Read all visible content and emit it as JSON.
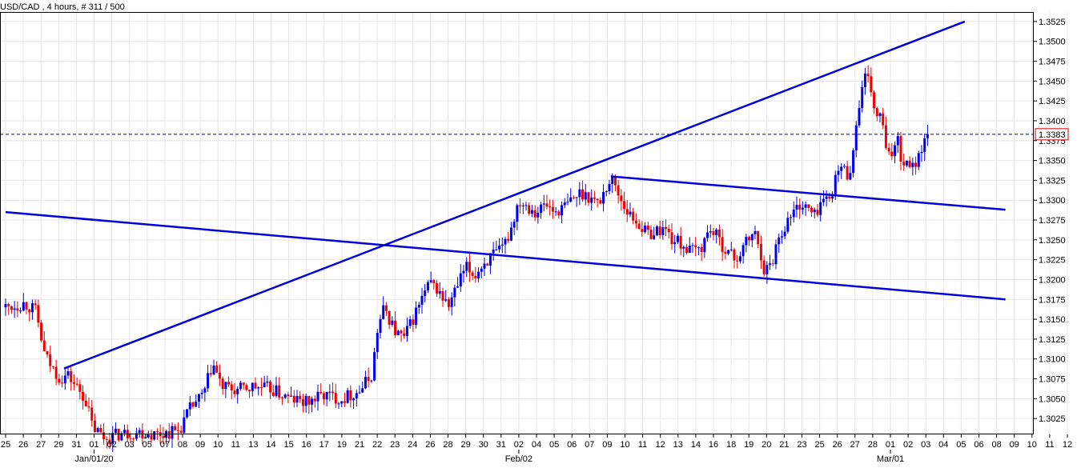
{
  "chart_data": {
    "type": "candlestick",
    "title": "USD/CAD , 4 hours, # 311 / 500",
    "y_ticks": [
      "1.3025",
      "1.3050",
      "1.3075",
      "1.3100",
      "1.3125",
      "1.3150",
      "1.3175",
      "1.3200",
      "1.3225",
      "1.3250",
      "1.3275",
      "1.3300",
      "1.3325",
      "1.3350",
      "1.3375",
      "1.3400",
      "1.3425",
      "1.3450",
      "1.3475",
      "1.3500",
      "1.3525"
    ],
    "ylim": [
      1.3005,
      1.3537
    ],
    "grid": true,
    "x_day_labels": [
      "25",
      "26",
      "27",
      "29",
      "31",
      "01",
      "02",
      "03",
      "05",
      "07",
      "08",
      "09",
      "10",
      "11",
      "13",
      "14",
      "15",
      "16",
      "17",
      "19",
      "21",
      "22",
      "23",
      "24",
      "26",
      "28",
      "29",
      "30",
      "31",
      "02",
      "04",
      "05",
      "06",
      "07",
      "09",
      "10",
      "11",
      "12",
      "13",
      "14",
      "16",
      "18",
      "19",
      "20",
      "21",
      "23",
      "25",
      "26",
      "27",
      "28",
      "01",
      "02",
      "03",
      "04",
      "05",
      "06",
      "08",
      "09",
      "10",
      "11",
      "12"
    ],
    "x_month_labels": [
      {
        "label": "Jan/01/20",
        "under_day": "01"
      },
      {
        "label": "Feb/02",
        "under_day": "02"
      },
      {
        "label": "Mar/01",
        "under_day": "01"
      }
    ],
    "current_price": "1.3383",
    "current_price_value": 1.3383,
    "trendlines": [
      {
        "name": "rising",
        "from": [
          3.3,
          1.3088
        ],
        "to": [
          54.2,
          1.3525
        ]
      },
      {
        "name": "lower-falling",
        "from": [
          0,
          1.3285
        ],
        "to": [
          56.5,
          1.3175
        ]
      },
      {
        "name": "upper-falling",
        "from": [
          34.2,
          1.333
        ],
        "to": [
          56.5,
          1.3288
        ]
      }
    ],
    "path": [
      [
        0,
        1.3165
      ],
      [
        1.1,
        1.317
      ],
      [
        1.7,
        1.316
      ],
      [
        2.2,
        1.3105
      ],
      [
        2.6,
        1.309
      ],
      [
        3.1,
        1.3075
      ],
      [
        3.5,
        1.308
      ],
      [
        4.0,
        1.3065
      ],
      [
        4.5,
        1.305
      ],
      [
        4.9,
        1.3015
      ],
      [
        5.6,
        1.3
      ],
      [
        6.4,
        1.3005
      ],
      [
        7.5,
        1.3008
      ],
      [
        8.5,
        1.3005
      ],
      [
        9.8,
        1.301
      ],
      [
        10.5,
        1.304
      ],
      [
        11.2,
        1.3055
      ],
      [
        11.7,
        1.3095
      ],
      [
        12.2,
        1.3065
      ],
      [
        13.0,
        1.306
      ],
      [
        14.0,
        1.3065
      ],
      [
        15.0,
        1.3062
      ],
      [
        16.0,
        1.305
      ],
      [
        17.0,
        1.3045
      ],
      [
        18.0,
        1.3055
      ],
      [
        19.0,
        1.305
      ],
      [
        20.0,
        1.306
      ],
      [
        20.7,
        1.308
      ],
      [
        21.0,
        1.3135
      ],
      [
        21.4,
        1.3165
      ],
      [
        22.0,
        1.3135
      ],
      [
        22.5,
        1.3125
      ],
      [
        23.0,
        1.315
      ],
      [
        23.6,
        1.318
      ],
      [
        24.0,
        1.3195
      ],
      [
        24.5,
        1.3185
      ],
      [
        25.0,
        1.3165
      ],
      [
        25.5,
        1.319
      ],
      [
        26.0,
        1.3215
      ],
      [
        26.5,
        1.3205
      ],
      [
        27.0,
        1.322
      ],
      [
        27.5,
        1.323
      ],
      [
        28.0,
        1.3235
      ],
      [
        28.5,
        1.326
      ],
      [
        29.0,
        1.33
      ],
      [
        29.4,
        1.3295
      ],
      [
        30.0,
        1.3285
      ],
      [
        30.5,
        1.3295
      ],
      [
        31.0,
        1.3285
      ],
      [
        31.5,
        1.329
      ],
      [
        32.0,
        1.33
      ],
      [
        32.5,
        1.331
      ],
      [
        33.0,
        1.3305
      ],
      [
        33.5,
        1.3295
      ],
      [
        34.0,
        1.332
      ],
      [
        34.3,
        1.3325
      ],
      [
        34.8,
        1.33
      ],
      [
        35.3,
        1.328
      ],
      [
        35.8,
        1.327
      ],
      [
        36.2,
        1.3258
      ],
      [
        36.7,
        1.326
      ],
      [
        37.2,
        1.3265
      ],
      [
        37.7,
        1.325
      ],
      [
        38.2,
        1.3245
      ],
      [
        38.7,
        1.3235
      ],
      [
        39.3,
        1.324
      ],
      [
        39.8,
        1.3265
      ],
      [
        40.3,
        1.325
      ],
      [
        40.8,
        1.3235
      ],
      [
        41.3,
        1.3225
      ],
      [
        41.8,
        1.3245
      ],
      [
        42.3,
        1.326
      ],
      [
        42.6,
        1.324
      ],
      [
        42.9,
        1.321
      ],
      [
        43.3,
        1.322
      ],
      [
        43.6,
        1.325
      ],
      [
        44.1,
        1.327
      ],
      [
        44.5,
        1.3285
      ],
      [
        44.9,
        1.3295
      ],
      [
        45.3,
        1.329
      ],
      [
        45.7,
        1.328
      ],
      [
        46.1,
        1.33
      ],
      [
        46.5,
        1.33
      ],
      [
        46.9,
        1.3325
      ],
      [
        47.2,
        1.3345
      ],
      [
        47.6,
        1.333
      ],
      [
        47.9,
        1.336
      ],
      [
        48.2,
        1.342
      ],
      [
        48.6,
        1.3455
      ],
      [
        48.9,
        1.344
      ],
      [
        49.2,
        1.34
      ],
      [
        49.5,
        1.341
      ],
      [
        49.8,
        1.335
      ],
      [
        50.1,
        1.336
      ],
      [
        50.4,
        1.3385
      ],
      [
        50.7,
        1.334
      ],
      [
        51.0,
        1.3355
      ],
      [
        51.3,
        1.334
      ],
      [
        51.6,
        1.336
      ],
      [
        51.9,
        1.337
      ],
      [
        52.1,
        1.3383
      ]
    ]
  }
}
